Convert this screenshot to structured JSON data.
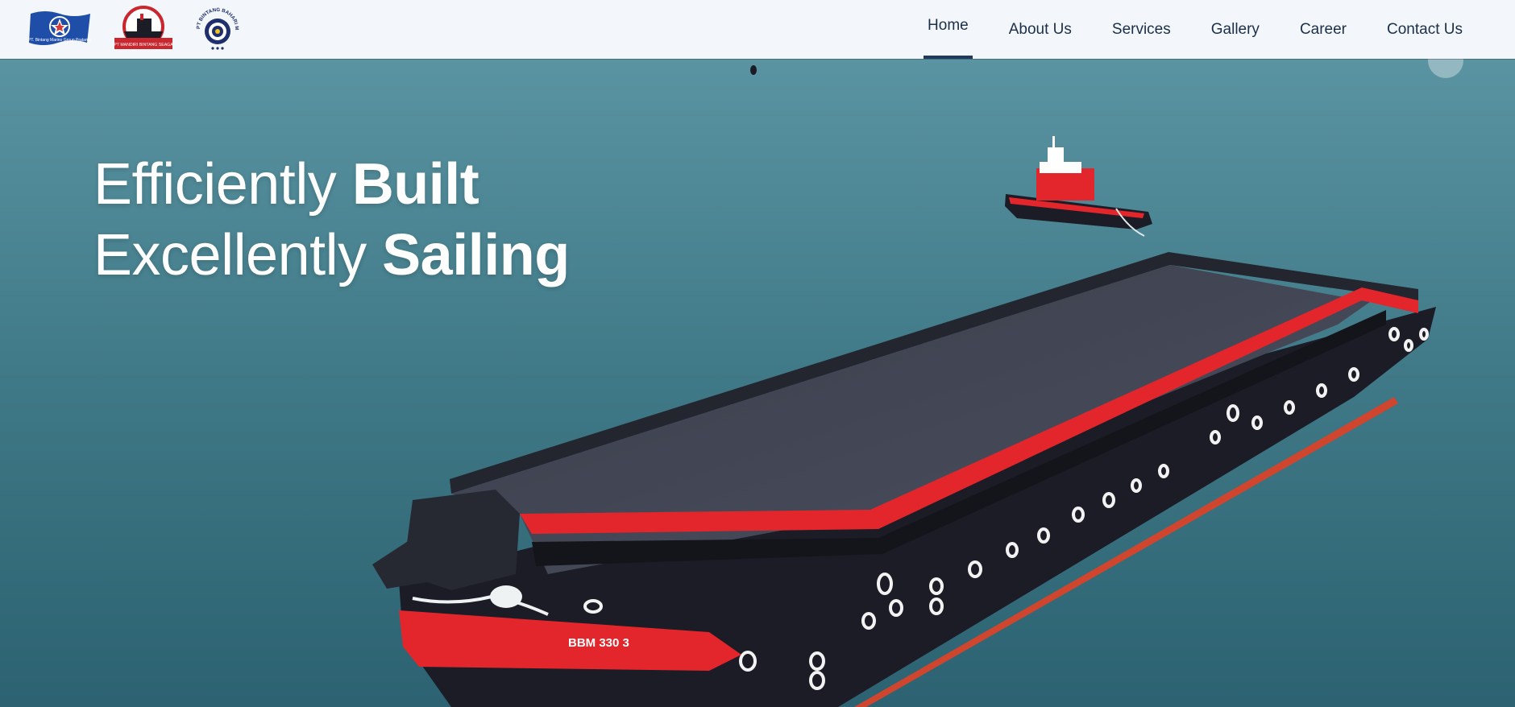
{
  "header": {
    "logos": [
      {
        "name": "bintang-company-flag-logo",
        "caption": "PT. Bintang Marino Group Pratama"
      },
      {
        "name": "mandiri-shipping-logo",
        "caption": "PT MANDIRI BINTANG SEAGA"
      },
      {
        "name": "bintang-bahari-maritim-logo",
        "caption": "PT BINTANG BAHARI MARITIM"
      }
    ],
    "nav": [
      {
        "label": "Home",
        "active": true
      },
      {
        "label": "About Us",
        "active": false
      },
      {
        "label": "Services",
        "active": false
      },
      {
        "label": "Gallery",
        "active": false
      },
      {
        "label": "Career",
        "active": false
      },
      {
        "label": "Contact Us",
        "active": false
      }
    ]
  },
  "hero": {
    "line1_light": "Efficiently ",
    "line1_bold": "Built",
    "line2_light": "Excellently ",
    "line2_bold": "Sailing",
    "barge_label": "BBM 330 3"
  },
  "colors": {
    "header_bg": "#f3f7fb",
    "nav_text": "#1c2f4a",
    "active_underline": "#1f3a60",
    "sea": "#3e7886",
    "barge_red": "#e3262b",
    "barge_hull": "#1b1c26"
  }
}
